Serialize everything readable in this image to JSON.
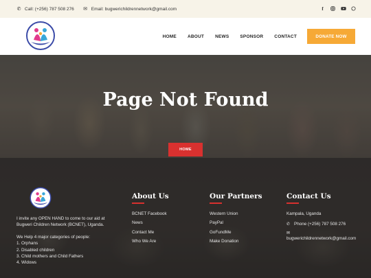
{
  "topbar": {
    "call": "Call: (+256) 787 508 276",
    "email": "Email: bugwerichildrennetwork@gmail.com",
    "social_icons": [
      "facebook-icon",
      "instagram-icon",
      "youtube-icon",
      "whatsapp-icon"
    ]
  },
  "nav": {
    "items": [
      "HOME",
      "ABOUT",
      "NEWS",
      "SPONSOR",
      "CONTACT"
    ],
    "donate": "DONATE NOW"
  },
  "hero": {
    "title": "Page Not Found",
    "button": "HOME"
  },
  "footer": {
    "about": {
      "intro": "I invite any OPEN HAND to come to our aid at Bugweri Children Network (BCNET), Uganda.",
      "categories_intro": "We Help 4 major categories of people:",
      "categories": [
        "1. Orphans",
        "2. Disabled children",
        "3. Child mothers and Child Fathers",
        "4. Widows"
      ]
    },
    "about_us": {
      "title": "About Us",
      "links": [
        "BCNET Facebook",
        "News",
        "Contact Me",
        "Who We Are"
      ]
    },
    "partners": {
      "title": "Our Partners",
      "links": [
        "Western Union",
        "PayPal",
        "GoFundMe",
        "Make Donation"
      ]
    },
    "contact": {
      "title": "Contact Us",
      "address": "Kampala, Uganda",
      "phone": "Phone (+256) 787 508 276",
      "email": "bugwerichildrennetwork@gmail.com"
    }
  },
  "colors": {
    "accent_red": "#d9312f",
    "donate_orange": "#f6a936",
    "topbar_bg": "#f7f3e8"
  }
}
